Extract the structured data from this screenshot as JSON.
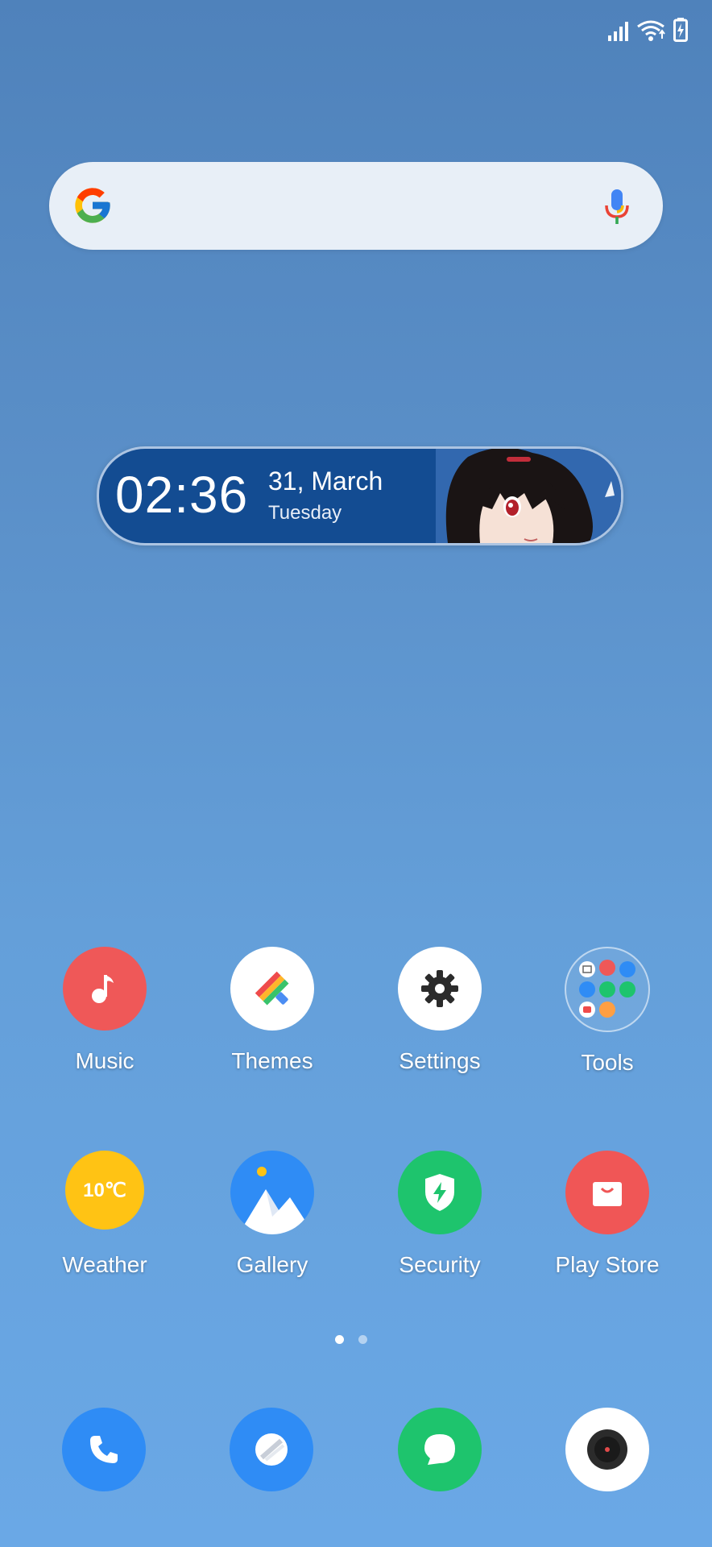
{
  "status_bar": {
    "icons": [
      "signal-icon",
      "wifi-icon",
      "battery-charging-icon"
    ]
  },
  "search": {
    "icons": [
      "google-icon",
      "mic-icon"
    ]
  },
  "clock_widget": {
    "time": "02:36",
    "date": "31, March",
    "day": "Tuesday"
  },
  "apps": [
    {
      "label": "Music",
      "color": "#ef5858",
      "icon": "music-note-icon"
    },
    {
      "label": "Themes",
      "color": "#ffffff",
      "icon": "paint-roller-icon"
    },
    {
      "label": "Settings",
      "color": "#ffffff",
      "icon": "gear-icon"
    },
    {
      "label": "Tools",
      "color": "transparent",
      "icon": "folder-icon"
    },
    {
      "label": "Weather",
      "color": "#ffc314",
      "icon": "weather-icon",
      "badge": "10℃"
    },
    {
      "label": "Gallery",
      "color": "#2f8cf5",
      "icon": "mountain-icon"
    },
    {
      "label": "Security",
      "color": "#1ec46d",
      "icon": "shield-icon"
    },
    {
      "label": "Play Store",
      "color": "#f05656",
      "icon": "shopping-bag-icon"
    }
  ],
  "page_indicator": {
    "pages": 2,
    "current": 1
  },
  "dock": [
    {
      "icon": "phone-icon",
      "color": "#2f8cf5"
    },
    {
      "icon": "browser-icon",
      "color": "#2f8cf5"
    },
    {
      "icon": "messages-icon",
      "color": "#1ec46d"
    },
    {
      "icon": "camera-icon",
      "color": "#ffffff"
    }
  ]
}
